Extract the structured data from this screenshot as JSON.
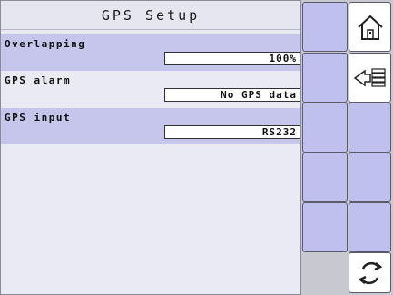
{
  "header": {
    "title": "GPS Setup"
  },
  "settings": [
    {
      "label": "Overlapping",
      "value": "100%"
    },
    {
      "label": "GPS alarm",
      "value": "No GPS data"
    },
    {
      "label": "GPS input",
      "value": "RS232"
    }
  ],
  "sidebar": {
    "icons": [
      "home-icon",
      "back-list-icon",
      "refresh-icon"
    ]
  },
  "colors": {
    "button_fill": "#c0c0ee",
    "row_shade": "#c6c6ec",
    "panel_bg": "#eaeaf4"
  }
}
